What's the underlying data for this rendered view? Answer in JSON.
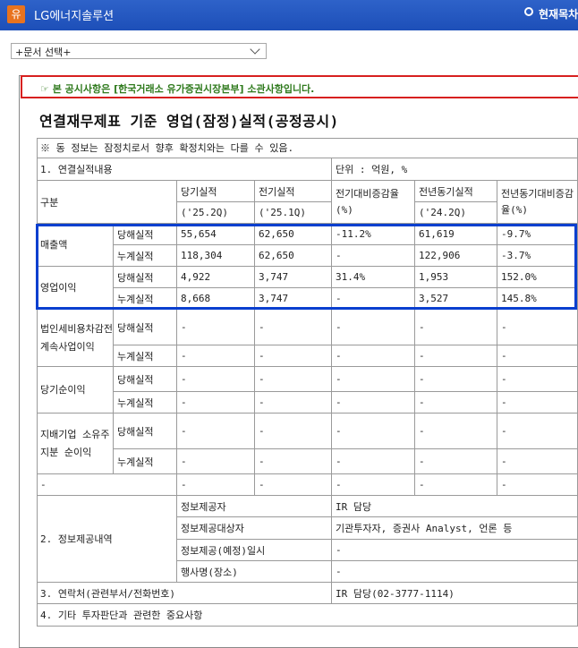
{
  "app": {
    "badge": "유",
    "company": "LG에너지솔루션",
    "current_label": "현재목차"
  },
  "doc_select": {
    "value": "+문서 선택+"
  },
  "notice": "☞ 본 공시사항은 [한국거래소 유가증권시장본부] 소관사항입니다.",
  "title": "연결재무제표 기준 영업(잠정)실적(공정공시)",
  "note": "※ 동 정보는 잠정치로서 향후 확정치와는 다를 수 있음.",
  "section1": "1. 연결실적내용",
  "unit": "단위 : 억원, %",
  "header": {
    "gubun": "구분",
    "current": "당기실적",
    "current_period": "('25.2Q)",
    "prev": "전기실적",
    "prev_period": "('25.1Q)",
    "qoq": "전기대비증감율(%)",
    "yoy_prev": "전년동기실적",
    "yoy_prev_period": "('24.2Q)",
    "yoy": "전년동기대비증감율(%)"
  },
  "rows": [
    {
      "group": "매출액",
      "sub": "당해실적",
      "v": [
        "55,654",
        "62,650",
        "-11.2%",
        "61,619",
        "-9.7%"
      ]
    },
    {
      "group": "",
      "sub": "누계실적",
      "v": [
        "118,304",
        "62,650",
        "-",
        "122,906",
        "-3.7%"
      ]
    },
    {
      "group": "영업이익",
      "sub": "당해실적",
      "v": [
        "4,922",
        "3,747",
        "31.4%",
        "1,953",
        "152.0%"
      ]
    },
    {
      "group": "",
      "sub": "누계실적",
      "v": [
        "8,668",
        "3,747",
        "-",
        "3,527",
        "145.8%"
      ]
    },
    {
      "group": "법인세비용차감전계속사업이익",
      "sub": "당해실적",
      "v": [
        "-",
        "-",
        "-",
        "-",
        "-"
      ]
    },
    {
      "group": "",
      "sub": "누계실적",
      "v": [
        "-",
        "-",
        "-",
        "-",
        "-"
      ]
    },
    {
      "group": "당기순이익",
      "sub": "당해실적",
      "v": [
        "-",
        "-",
        "-",
        "-",
        "-"
      ]
    },
    {
      "group": "",
      "sub": "누계실적",
      "v": [
        "-",
        "-",
        "-",
        "-",
        "-"
      ]
    },
    {
      "group": "지배기업 소유주지분 순이익",
      "sub": "당해실적",
      "v": [
        "-",
        "-",
        "-",
        "-",
        "-"
      ]
    },
    {
      "group": "",
      "sub": "누계실적",
      "v": [
        "-",
        "-",
        "-",
        "-",
        "-"
      ]
    },
    {
      "group": "-",
      "sub": "",
      "v": [
        "-",
        "-",
        "-",
        "-",
        "-"
      ]
    }
  ],
  "section2": {
    "label": "2. 정보제공내역",
    "items": [
      {
        "k": "정보제공자",
        "v": "IR 담당"
      },
      {
        "k": "정보제공대상자",
        "v": "기관투자자, 증권사 Analyst, 언론 등"
      },
      {
        "k": "정보제공(예정)일시",
        "v": "-"
      },
      {
        "k": "행사명(장소)",
        "v": "-"
      }
    ]
  },
  "section3": {
    "label": "3. 연락처(관련부서/전화번호)",
    "value": "IR 담당(02-3777-1114)"
  },
  "section4": {
    "label": "4. 기타 투자판단과 관련한 중요사항"
  }
}
